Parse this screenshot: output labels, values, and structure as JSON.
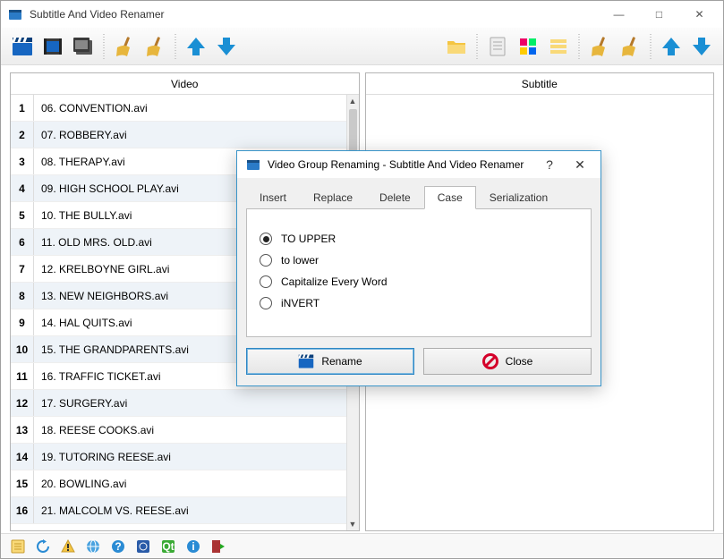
{
  "app": {
    "title": "Subtitle And Video Renamer",
    "panels": {
      "video": "Video",
      "subtitle": "Subtitle"
    }
  },
  "toolbar_left": [
    {
      "name": "clapper-blue",
      "icon": "clapper-b"
    },
    {
      "name": "film-open",
      "icon": "film"
    },
    {
      "name": "film-multi",
      "icon": "film2"
    },
    {
      "sep": true
    },
    {
      "name": "broom-1",
      "icon": "broom"
    },
    {
      "name": "broom-2",
      "icon": "broom"
    },
    {
      "sep": true
    },
    {
      "name": "arrow-up",
      "icon": "aup"
    },
    {
      "name": "arrow-down",
      "icon": "adown"
    }
  ],
  "toolbar_right": [
    {
      "name": "folder",
      "icon": "folder"
    },
    {
      "sep": true
    },
    {
      "name": "page-1",
      "icon": "page"
    },
    {
      "name": "page-colors",
      "icon": "pagec"
    },
    {
      "name": "page-rows",
      "icon": "pager"
    },
    {
      "sep": true
    },
    {
      "name": "broom-3",
      "icon": "broom"
    },
    {
      "name": "broom-4",
      "icon": "broom"
    },
    {
      "sep": true
    },
    {
      "name": "arrow-up-2",
      "icon": "aup"
    },
    {
      "name": "arrow-down-2",
      "icon": "adown"
    }
  ],
  "video_list": [
    {
      "n": "1",
      "t": "06. CONVENTION.avi"
    },
    {
      "n": "2",
      "t": "07. ROBBERY.avi"
    },
    {
      "n": "3",
      "t": "08. THERAPY.avi"
    },
    {
      "n": "4",
      "t": "09. HIGH SCHOOL PLAY.avi"
    },
    {
      "n": "5",
      "t": "10. THE BULLY.avi"
    },
    {
      "n": "6",
      "t": "11. OLD MRS. OLD.avi"
    },
    {
      "n": "7",
      "t": "12. KRELBOYNE GIRL.avi"
    },
    {
      "n": "8",
      "t": "13. NEW NEIGHBORS.avi"
    },
    {
      "n": "9",
      "t": "14. HAL QUITS.avi"
    },
    {
      "n": "10",
      "t": "15. THE GRANDPARENTS.avi"
    },
    {
      "n": "11",
      "t": "16. TRAFFIC TICKET.avi"
    },
    {
      "n": "12",
      "t": "17. SURGERY.avi"
    },
    {
      "n": "13",
      "t": "18. REESE COOKS.avi"
    },
    {
      "n": "14",
      "t": "19. TUTORING REESE.avi"
    },
    {
      "n": "15",
      "t": "20. BOWLING.avi"
    },
    {
      "n": "16",
      "t": "21. MALCOLM VS. REESE.avi"
    }
  ],
  "dialog": {
    "title": "Video Group Renaming - Subtitle And Video Renamer",
    "tabs": [
      "Insert",
      "Replace",
      "Delete",
      "Case",
      "Serialization"
    ],
    "active_tab": 3,
    "case_options": [
      "TO UPPER",
      "to lower",
      "Capitalize Every Word",
      "iNVERT"
    ],
    "selected_option": 0,
    "buttons": {
      "rename": "Rename",
      "close": "Close"
    }
  },
  "status_icons": [
    "list",
    "refresh",
    "warn",
    "globe",
    "help",
    "un",
    "qt",
    "info",
    "exit"
  ]
}
